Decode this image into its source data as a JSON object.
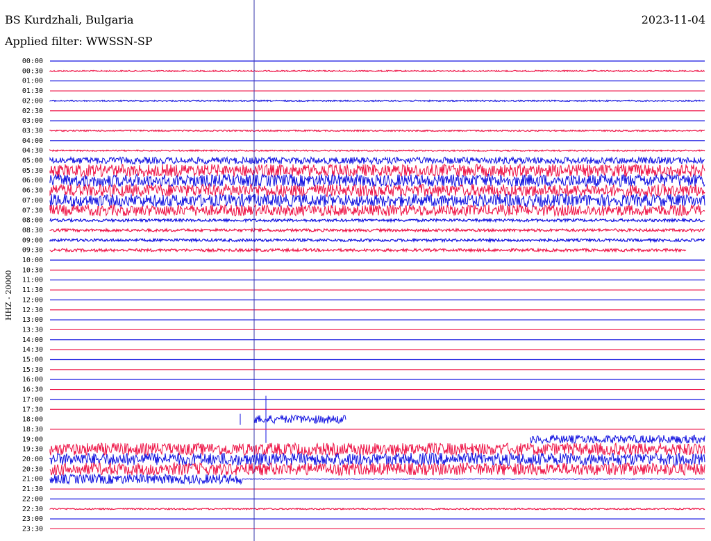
{
  "header": {
    "station": "BS Kurdzhali, Bulgaria",
    "filter": "Applied filter: WWSSN-SP",
    "date": "2023-11-04"
  },
  "colors": {
    "blue": "#1010e0",
    "red": "#ee1144",
    "cursor": "#3333aa"
  },
  "chart_data": {
    "type": "line",
    "ylabel": "HHZ - 20000",
    "rows": [
      {
        "label": "00:00",
        "color": "blue",
        "amp": 0
      },
      {
        "label": "00:30",
        "color": "red",
        "amp": 1
      },
      {
        "label": "01:00",
        "color": "blue",
        "amp": 0
      },
      {
        "label": "01:30",
        "color": "red",
        "amp": 0
      },
      {
        "label": "02:00",
        "color": "blue",
        "amp": 1
      },
      {
        "label": "02:30",
        "color": "red",
        "amp": 0
      },
      {
        "label": "03:00",
        "color": "blue",
        "amp": 0
      },
      {
        "label": "03:30",
        "color": "red",
        "amp": 1
      },
      {
        "label": "04:00",
        "color": "blue",
        "amp": 0
      },
      {
        "label": "04:30",
        "color": "red",
        "amp": 1
      },
      {
        "label": "05:00",
        "color": "blue",
        "amp": 5
      },
      {
        "label": "05:30",
        "color": "red",
        "amp": 9
      },
      {
        "label": "06:00",
        "color": "blue",
        "amp": 9
      },
      {
        "label": "06:30",
        "color": "red",
        "amp": 9
      },
      {
        "label": "07:00",
        "color": "blue",
        "amp": 9
      },
      {
        "label": "07:30",
        "color": "red",
        "amp": 8
      },
      {
        "label": "08:00",
        "color": "blue",
        "amp": 2
      },
      {
        "label": "08:30",
        "color": "red",
        "amp": 2
      },
      {
        "label": "09:00",
        "color": "blue",
        "amp": 2
      },
      {
        "label": "09:30",
        "color": "red",
        "amp": 2
      },
      {
        "label": "10:00",
        "color": "blue",
        "amp": 0
      },
      {
        "label": "10:30",
        "color": "red",
        "amp": 0
      },
      {
        "label": "11:00",
        "color": "blue",
        "amp": 0
      },
      {
        "label": "11:30",
        "color": "red",
        "amp": 0
      },
      {
        "label": "12:00",
        "color": "blue",
        "amp": 0
      },
      {
        "label": "12:30",
        "color": "red",
        "amp": 0
      },
      {
        "label": "13:00",
        "color": "blue",
        "amp": 0
      },
      {
        "label": "13:30",
        "color": "red",
        "amp": 0
      },
      {
        "label": "14:00",
        "color": "blue",
        "amp": 0
      },
      {
        "label": "14:30",
        "color": "red",
        "amp": 0
      },
      {
        "label": "15:00",
        "color": "blue",
        "amp": 0
      },
      {
        "label": "15:30",
        "color": "red",
        "amp": 0
      },
      {
        "label": "16:00",
        "color": "blue",
        "amp": 0
      },
      {
        "label": "16:30",
        "color": "red",
        "amp": 0
      },
      {
        "label": "17:00",
        "color": "blue",
        "amp": 0
      },
      {
        "label": "17:30",
        "color": "red",
        "amp": 0
      },
      {
        "label": "18:00",
        "color": "blue",
        "amp": 6
      },
      {
        "label": "18:30",
        "color": "red",
        "amp": 0
      },
      {
        "label": "19:00",
        "color": "blue",
        "amp": 6
      },
      {
        "label": "19:30",
        "color": "red",
        "amp": 9
      },
      {
        "label": "20:00",
        "color": "blue",
        "amp": 9
      },
      {
        "label": "20:30",
        "color": "red",
        "amp": 9
      },
      {
        "label": "21:00",
        "color": "blue",
        "amp": 7
      },
      {
        "label": "21:30",
        "color": "red",
        "amp": 0
      },
      {
        "label": "22:00",
        "color": "blue",
        "amp": 0
      },
      {
        "label": "22:30",
        "color": "red",
        "amp": 1
      },
      {
        "label": "23:00",
        "color": "blue",
        "amp": 0
      },
      {
        "label": "23:30",
        "color": "red",
        "amp": 0
      }
    ]
  }
}
